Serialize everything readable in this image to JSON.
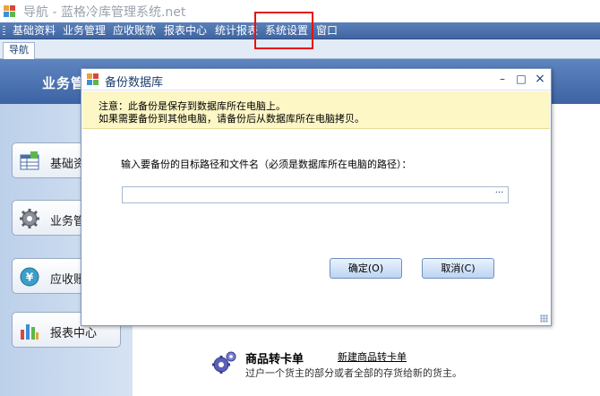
{
  "window": {
    "title": "导航 - 蓝格冷库管理系统.net"
  },
  "menu": {
    "items": [
      "基础资料",
      "业务管理",
      "应收账款",
      "报表中心",
      "统计报表",
      "系统设置",
      "窗口"
    ]
  },
  "tabs": [
    "导航"
  ],
  "page": {
    "header": "业务管"
  },
  "nav": {
    "items": [
      {
        "label": "基础资",
        "icon": "database-table-icon"
      },
      {
        "label": "业务管",
        "icon": "gear-icon"
      },
      {
        "label": "应收账",
        "icon": "yen-coin-icon"
      },
      {
        "label": "报表中心",
        "icon": "bar-chart-icon"
      }
    ]
  },
  "feature": {
    "title": "商品转卡单",
    "link": "新建商品转卡单",
    "description": "过户一个货主的部分或者全部的存货给新的货主。",
    "icon": "gears-icon"
  },
  "dialog": {
    "title": "备份数据库",
    "notice_line1": "注意：此备份是保存到数据库所在电脑上。",
    "notice_line2": "如果需要备份到其他电脑，请备份后从数据库所在电脑拷贝。",
    "prompt": "输入要备份的目标路径和文件名（必须是数据库所在电脑的路径）：",
    "path_value": "",
    "browse_label": "···",
    "ok_label": "确定(O)",
    "cancel_label": "取消(C)",
    "controls": {
      "minimize": "–",
      "maximize": "□",
      "close": "×"
    }
  },
  "colors": {
    "menubar": "#4a70ad",
    "notice_bg": "#fdf6c5",
    "highlight": "#e81010",
    "button": "#bcd4f2"
  }
}
